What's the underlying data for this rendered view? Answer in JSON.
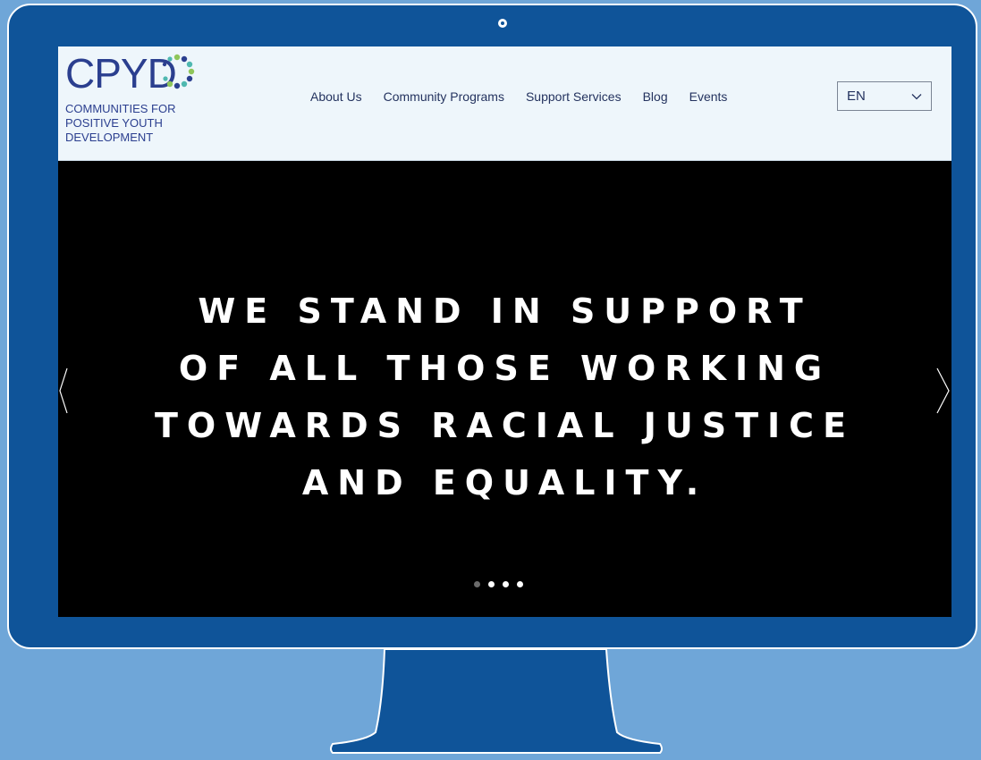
{
  "logo": {
    "wordmark": "CPYD",
    "tagline": "Communities for Positive Youth Development"
  },
  "nav": {
    "items": [
      "About Us",
      "Community Programs",
      "Support Services",
      "Blog",
      "Events"
    ]
  },
  "language": {
    "selected": "EN"
  },
  "hero": {
    "lines": [
      "We stand in support",
      "of all those working",
      "towards racial justice",
      "and equality."
    ]
  },
  "slider": {
    "total_slides": 4,
    "active_index": 0
  },
  "colors": {
    "background": "#6fa6d8",
    "monitor": "#0f5499",
    "brand_navy": "#2b3f8f",
    "brand_teal": "#4fb8b0",
    "brand_green": "#8fc65a",
    "header_bg": "#eef6fb"
  }
}
